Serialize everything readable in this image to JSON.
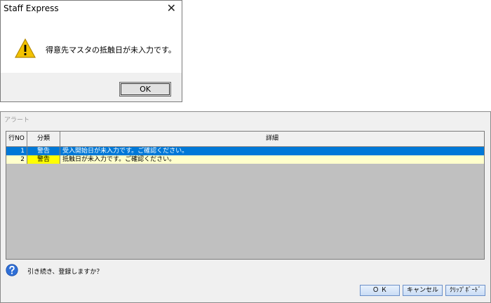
{
  "msgbox": {
    "title": "Staff Express",
    "close_label": "✕",
    "message": "得意先マスタの抵触日が未入力です。",
    "ok_label": "OK",
    "icon": "warning-icon"
  },
  "alert": {
    "title": "アラート",
    "columns": {
      "no": "行NO",
      "category": "分類",
      "detail": "詳細"
    },
    "rows": [
      {
        "no": "1",
        "category": "警告",
        "detail": "受入開始日が未入力です。ご確認ください。",
        "selected": true
      },
      {
        "no": "2",
        "category": "警告",
        "detail": "抵触日が未入力です。ご確認ください。",
        "selected": false
      }
    ],
    "question": "引き続き、登録しますか？",
    "question_icon": "question-icon",
    "buttons": {
      "ok": "Ｏ Ｋ",
      "cancel": "キャンセル",
      "clipboard": "ｸﾘｯﾌﾟﾎﾞｰﾄﾞ"
    }
  },
  "colors": {
    "selected_row": "#0078d7",
    "warning_row": "#ffffcc",
    "warning_cell": "#ffff00"
  }
}
